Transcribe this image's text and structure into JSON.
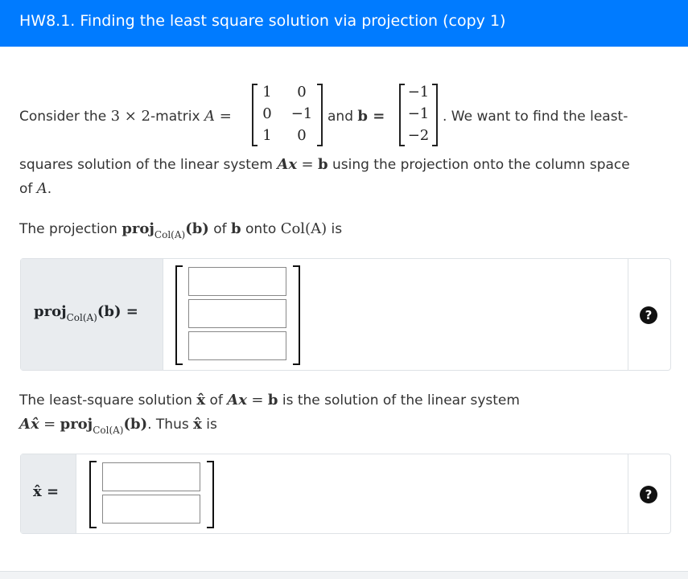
{
  "header": {
    "title": "HW8.1. Finding the least square solution via projection (copy 1)"
  },
  "problem": {
    "consider": "Consider the",
    "dims": "3 × 2",
    "matrix_word": "-matrix",
    "A_eq": "A =",
    "and": "and",
    "b_eq": "b =",
    "want": ". We want to find the least-",
    "line2a": "squares solution of the linear system",
    "Ax": "Ax",
    "eq": "=",
    "b": "b",
    "line2b": "using the projection onto the column space",
    "line3a": "of",
    "A": "A",
    "line3b": ".",
    "matrixA": [
      [
        "1",
        "0"
      ],
      [
        "0",
        "−1"
      ],
      [
        "1",
        "0"
      ]
    ],
    "vectorB": [
      "−1",
      "−1",
      "−2"
    ]
  },
  "projection_sentence": {
    "pre": "The projection",
    "proj": "proj",
    "col": "Col(A)",
    "arg": "(b)",
    "of": "of",
    "b": "b",
    "onto": "onto",
    "colA": "Col(A)",
    "is": "is"
  },
  "answer1": {
    "label_proj": "proj",
    "label_sub": "Col(A)",
    "label_arg": "(b) =",
    "help": "?"
  },
  "solution_sentence": {
    "pre": "The least-square solution",
    "xhat": "x̂",
    "of": "of",
    "Ax": "Ax",
    "eq": "=",
    "b": "b",
    "post": "is the solution of the linear system",
    "line2_lhs": "Ax̂",
    "line2_eq": "=",
    "line2_proj": "proj",
    "line2_sub": "Col(A)",
    "line2_arg": "(b)",
    "line2_thus": ". Thus",
    "line2_xhat": "x̂",
    "line2_is": "is"
  },
  "answer2": {
    "label": "x̂ =",
    "help": "?"
  }
}
